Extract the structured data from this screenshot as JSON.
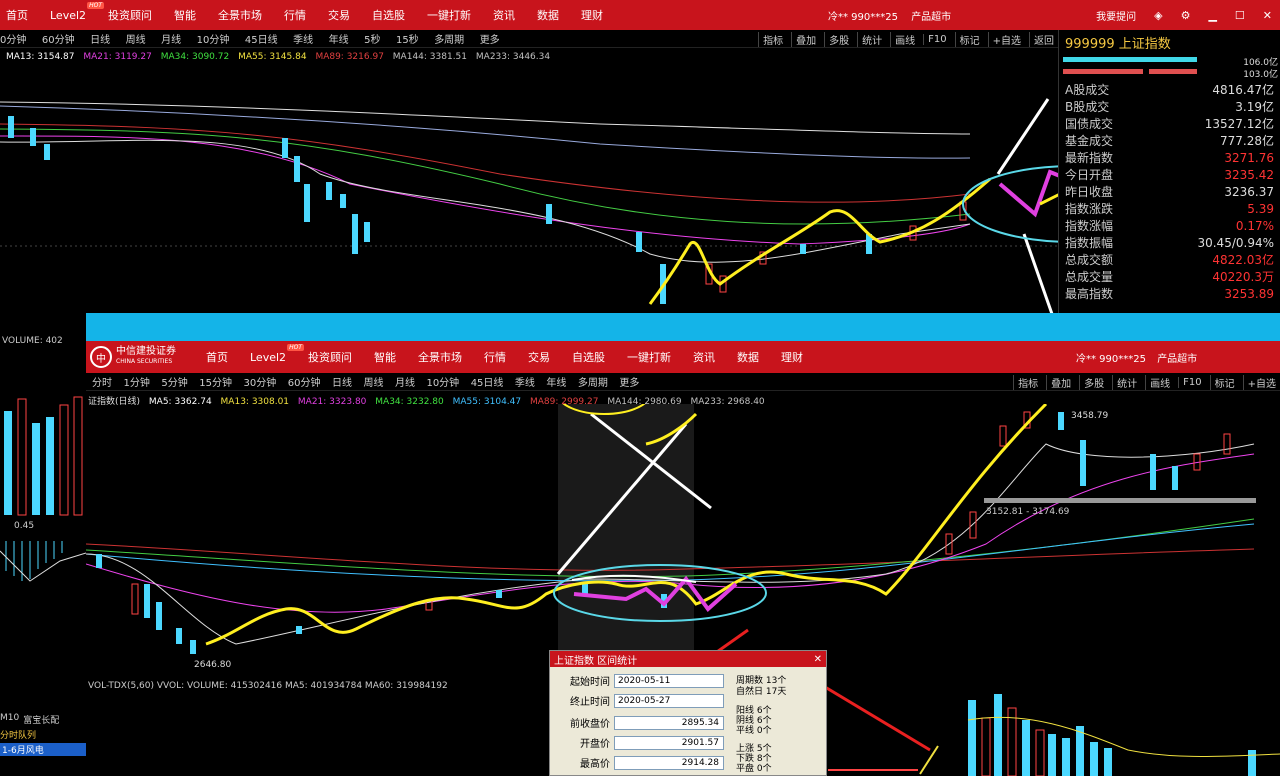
{
  "top_window": {
    "nav": [
      "首页",
      "Level2",
      "投资顾问",
      "智能",
      "全景市场",
      "行情",
      "交易",
      "自选股",
      "一键打新",
      "资讯",
      "数据",
      "理财"
    ],
    "hot_badge": "HOT",
    "user": "冷** 990***25",
    "product": "产品超市",
    "advisor": "我要提问",
    "periods": [
      "0分钟",
      "60分钟",
      "日线",
      "周线",
      "月线",
      "10分钟",
      "45日线",
      "季线",
      "年线",
      "5秒",
      "15秒",
      "多周期",
      "更多"
    ],
    "tools": [
      "指标",
      "叠加",
      "多股",
      "统计",
      "画线",
      "F10",
      "标记",
      "+自选",
      "返回"
    ],
    "ma": [
      {
        "label": "MA13: 3154.87",
        "color": "#ffffff"
      },
      {
        "label": "MA21: 3119.27",
        "color": "#f0e040"
      },
      {
        "label": "MA34: 3090.72",
        "color": "#e040e0"
      },
      {
        "label": "MA55: 3145.84",
        "color": "#40e040"
      },
      {
        "label": "MA89: 3216.97",
        "color": "#e04040"
      },
      {
        "label": "MA144: 3381.51",
        "color": "#c0c0c0"
      },
      {
        "label": "MA233: 3446.34",
        "color": "#c0c0c0"
      }
    ],
    "right_panel": {
      "title": "999999 上证指数",
      "rows": [
        {
          "k": "A股成交",
          "v": "4816.47亿"
        },
        {
          "k": "B股成交",
          "v": "3.19亿"
        },
        {
          "k": "国债成交",
          "v": "13527.12亿"
        },
        {
          "k": "基金成交",
          "v": "777.28亿"
        },
        {
          "k": "最新指数",
          "v": "3271.76"
        },
        {
          "k": "今日开盘",
          "v": "3235.42"
        },
        {
          "k": "昨日收盘",
          "v": "3236.37"
        },
        {
          "k": "指数涨跌",
          "v": "5.39"
        },
        {
          "k": "指数涨幅",
          "v": "0.17%"
        },
        {
          "k": "指数振幅",
          "v": "30.45/0.94%"
        },
        {
          "k": "总成交额",
          "v": "4822.03亿"
        },
        {
          "k": "总成交量",
          "v": "40220.3万"
        },
        {
          "k": "最高指数",
          "v": "3253.89"
        }
      ],
      "top_value": "106.0亿",
      "top_value2": "103.0亿"
    },
    "volume_label": "VOLUME: 402",
    "left_bottom_tabs": [
      "M10",
      "富宝长配",
      "分时队列",
      "1-6月风电"
    ],
    "left_value": "0.45"
  },
  "bottom_window": {
    "brand": "中信建投证券",
    "brand_en": "CHINA SECURITIES",
    "nav": [
      "首页",
      "Level2",
      "投资顾问",
      "智能",
      "全景市场",
      "行情",
      "交易",
      "自选股",
      "一键打新",
      "资讯",
      "数据",
      "理财"
    ],
    "user": "冷** 990***25",
    "product": "产品超市",
    "periods": [
      "分时",
      "1分钟",
      "5分钟",
      "15分钟",
      "30分钟",
      "60分钟",
      "日线",
      "周线",
      "月线",
      "10分钟",
      "45日线",
      "季线",
      "年线",
      "多周期",
      "更多"
    ],
    "tools": [
      "指标",
      "叠加",
      "多股",
      "统计",
      "画线",
      "F10",
      "标记",
      "+自选"
    ],
    "title": "证指数(日线)",
    "ma": [
      {
        "label": "MA5: 3362.74",
        "color": "#ffffff"
      },
      {
        "label": "MA13: 3308.01",
        "color": "#f0e040"
      },
      {
        "label": "MA21: 3323.80",
        "color": "#e040e0"
      },
      {
        "label": "MA34: 3232.80",
        "color": "#40e040"
      },
      {
        "label": "MA55: 3104.47",
        "color": "#40c0ff"
      },
      {
        "label": "MA89: 2999.27",
        "color": "#e04040"
      },
      {
        "label": "MA144: 2980.69",
        "color": "#c0c0c0"
      },
      {
        "label": "MA233: 2968.40",
        "color": "#c0c0c0"
      }
    ],
    "high_label": "3458.79",
    "low_label": "2646.80",
    "range_label": "3152.81 - 3174.69",
    "volume_line": "VOL-TDX(5,60)  VVOL: VOLUME: 415302416  MA5: 401934784  MA60: 319984192",
    "dialog": {
      "title": "上证指数 区间统计",
      "start_label": "起始时间",
      "start_value": "2020-05-11",
      "end_label": "终止时间",
      "end_value": "2020-05-27",
      "prev_close_label": "前收盘价",
      "prev_close_value": "2895.34",
      "open_label": "开盘价",
      "open_value": "2901.57",
      "close_label": "最高价",
      "close_value": "2914.28",
      "stats": [
        "周期数 13个",
        "自然日 17天",
        "阳线 6个",
        "阴线 6个",
        "平线 0个",
        "上涨 5个",
        "下跌 8个",
        "平盘 0个"
      ]
    }
  }
}
